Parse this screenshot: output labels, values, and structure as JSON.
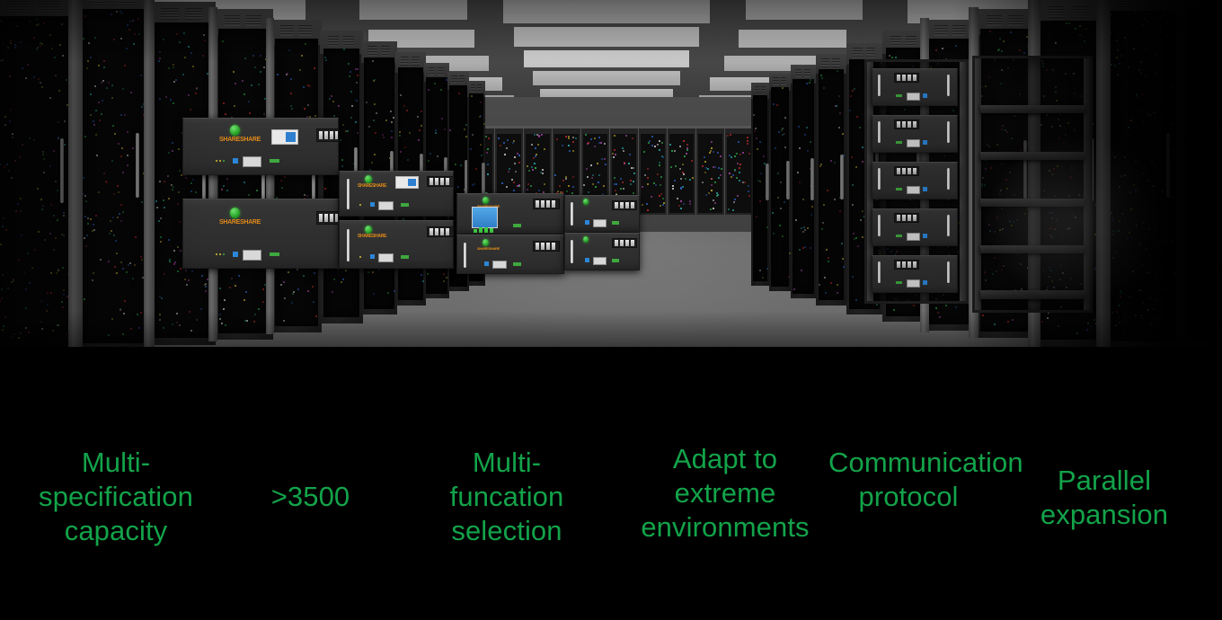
{
  "banner": {
    "background_color": "#000000",
    "accent_color": "#13a34a",
    "brand_logo_color": "#e08a18",
    "brand_mark_color": "#29a329"
  },
  "photo": {
    "scene_name": "data-center-aisle-with-battery-energy-storage-modules",
    "brand_text": "SHARESHARE",
    "floor_color": "#6a6a6a",
    "ceiling_color": "#4a4a4a",
    "rack_color": "#232323",
    "display_color": "#2f7fd0"
  },
  "features": [
    {
      "id": "multi-specification-capacity",
      "label": "Multi-specification capacity"
    },
    {
      "id": "cycle-count",
      "label": ">3500"
    },
    {
      "id": "multi-function-selection",
      "label": "Multi-funcation selection"
    },
    {
      "id": "extreme-environments",
      "label": "Adapt to extreme environments"
    },
    {
      "id": "communication-protocol",
      "label": "Communication protocol"
    },
    {
      "id": "parallel-expansion",
      "label": "Parallel expansion"
    }
  ]
}
